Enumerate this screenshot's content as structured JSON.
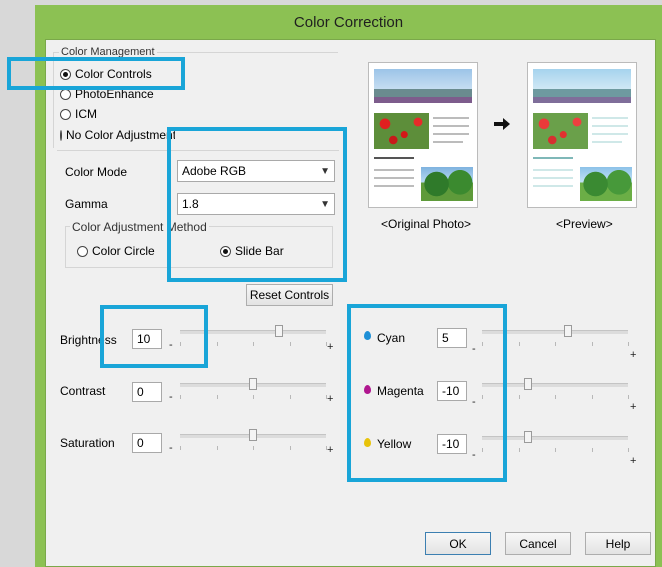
{
  "window": {
    "title": "Color Correction"
  },
  "color_management": {
    "legend": "Color Management",
    "options": [
      {
        "label": "Color Controls",
        "checked": true
      },
      {
        "label": "PhotoEnhance",
        "checked": false
      },
      {
        "label": "ICM",
        "checked": false
      },
      {
        "label": "No Color Adjustment",
        "checked": false
      }
    ]
  },
  "settings": {
    "color_mode_label": "Color Mode",
    "color_mode_value": "Adobe RGB",
    "gamma_label": "Gamma",
    "gamma_value": "1.8",
    "method_legend": "Color Adjustment Method",
    "method_options": [
      {
        "label": "Color Circle",
        "checked": false
      },
      {
        "label": "Slide Bar",
        "checked": true
      }
    ],
    "reset_label": "Reset Controls"
  },
  "preview": {
    "original_caption": "<Original Photo>",
    "preview_caption": "<Preview>",
    "arrow_icon": "arrow-right-icon"
  },
  "sliders_left": [
    {
      "label": "Brightness",
      "value": "10",
      "level": 10
    },
    {
      "label": "Contrast",
      "value": "0",
      "level": 0
    },
    {
      "label": "Saturation",
      "value": "0",
      "level": 0
    }
  ],
  "sliders_right": [
    {
      "label": "Cyan",
      "value": "5",
      "level": 5,
      "color": "#1e8fd6"
    },
    {
      "label": "Magenta",
      "value": "-10",
      "level": -10,
      "color": "#b0168f"
    },
    {
      "label": "Yellow",
      "value": "-10",
      "level": -10,
      "color": "#e8c30a"
    }
  ],
  "slider_signs": {
    "minus": "-",
    "plus": "+"
  },
  "buttons": {
    "ok": "OK",
    "cancel": "Cancel",
    "help": "Help"
  },
  "colors": {
    "title_bar": "#8cc153",
    "highlight": "#19a5d8"
  }
}
